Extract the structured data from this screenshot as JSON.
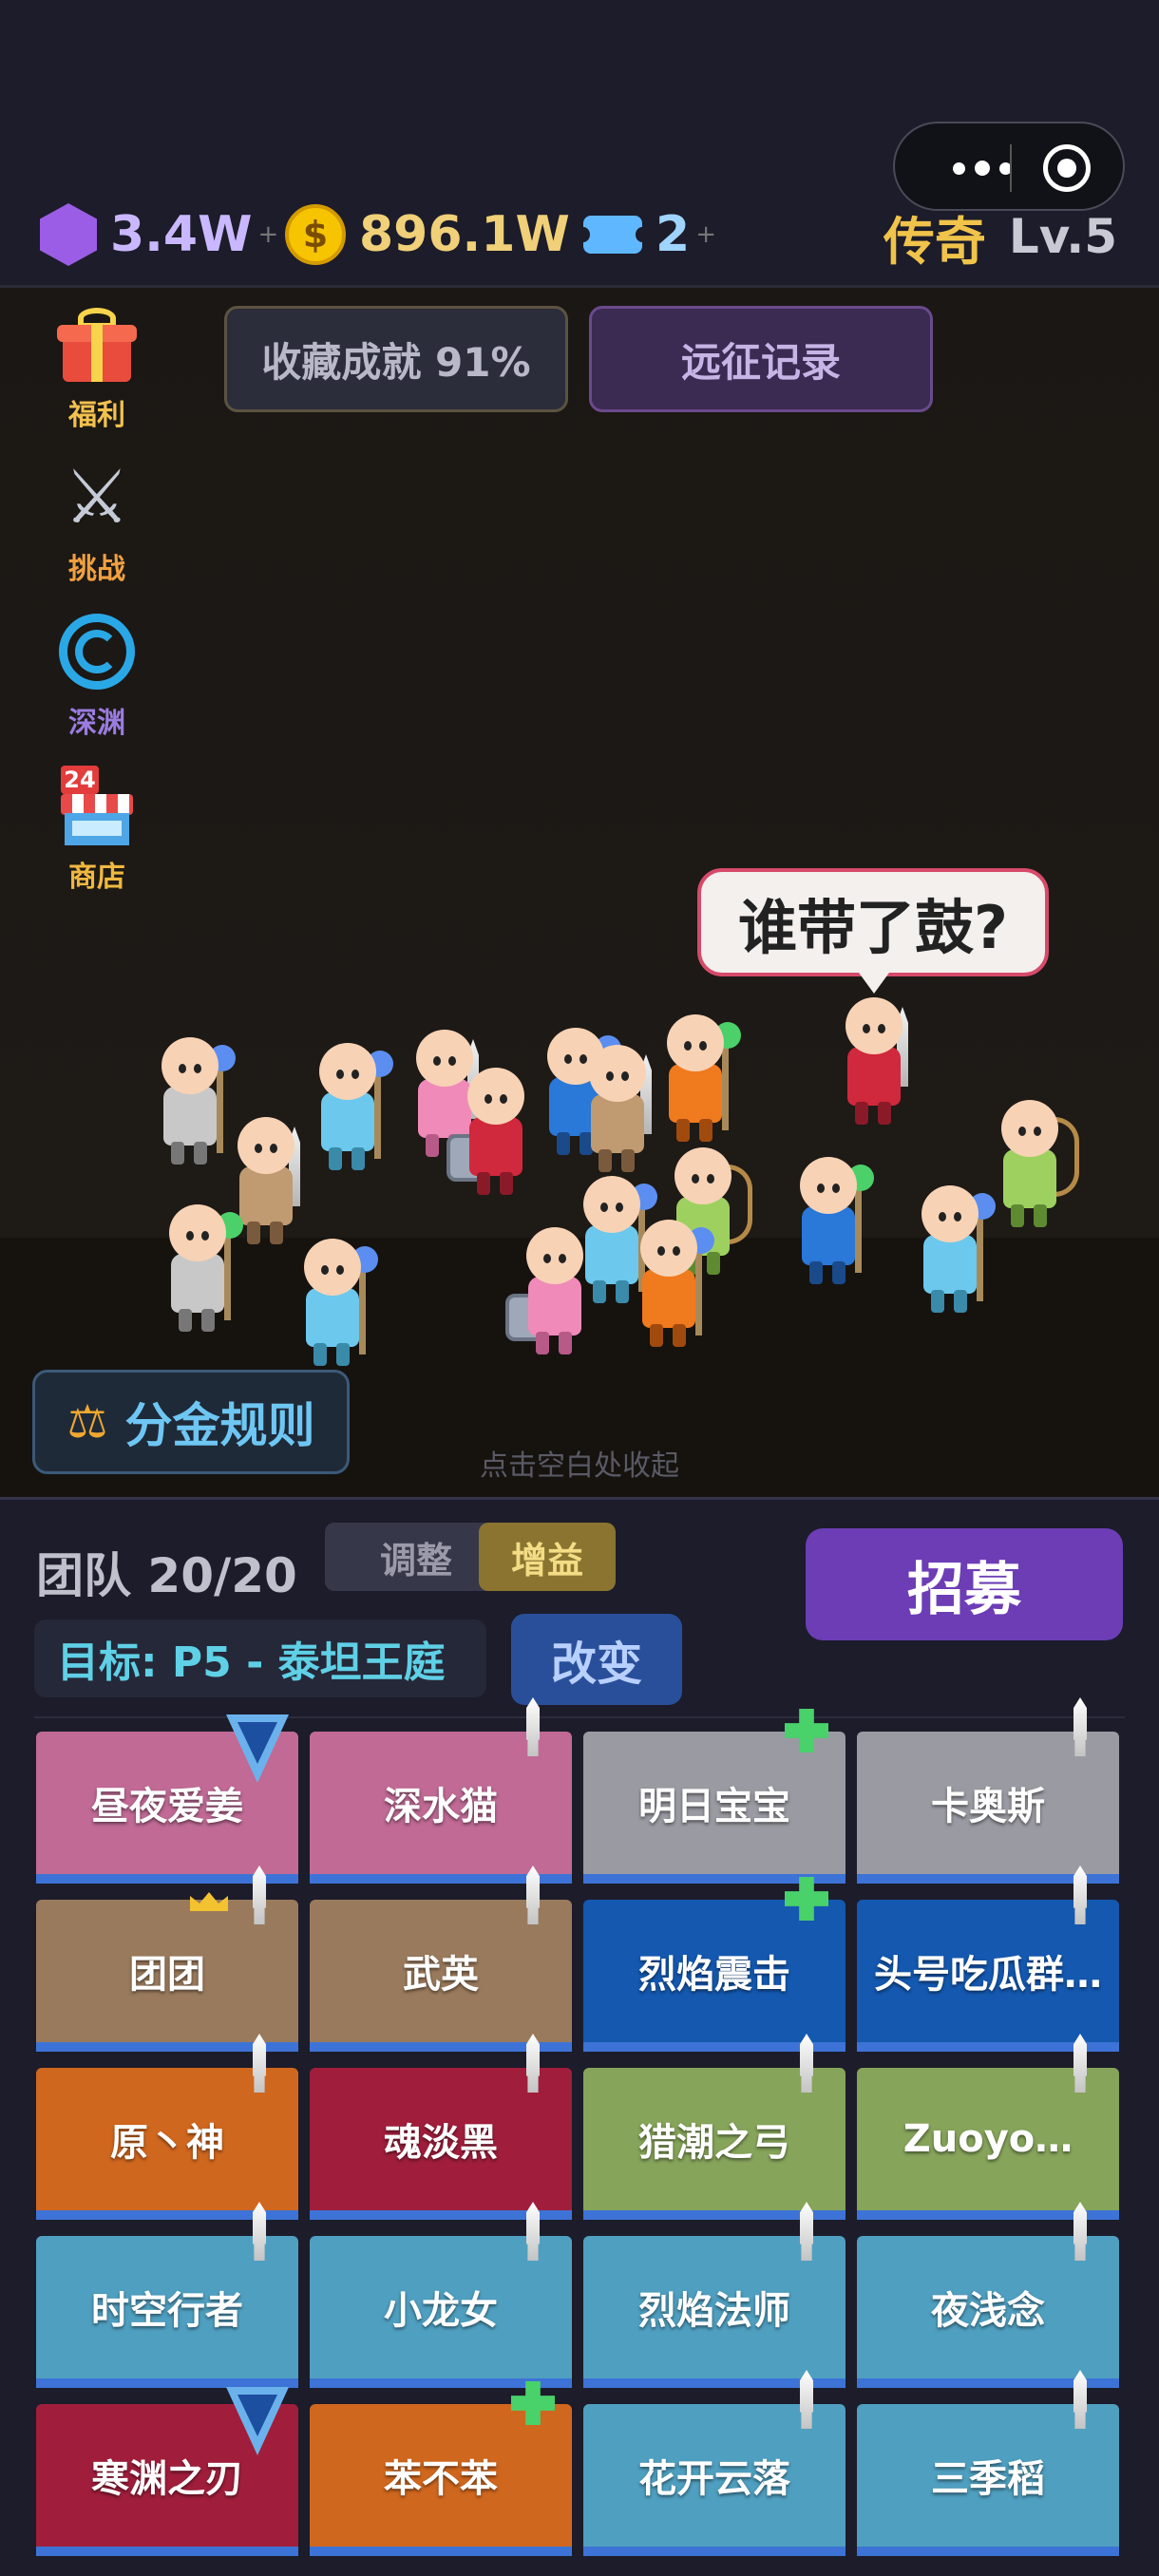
{
  "resources": {
    "gems": "3.4W",
    "coins": "896.1W",
    "coin_symbol": "$",
    "tickets": "2",
    "plus": "+"
  },
  "rank": {
    "title": "传奇",
    "level": "Lv.5"
  },
  "side_menu": [
    {
      "label": "福利",
      "color": "#f2c14e",
      "icon": "gift-icon"
    },
    {
      "label": "挑战",
      "color": "#f0a040",
      "icon": "crossed-swords-icon"
    },
    {
      "label": "深渊",
      "color": "#9b7ce0",
      "icon": "vortex-icon"
    },
    {
      "label": "商店",
      "color": "#f0b840",
      "icon": "shop-icon",
      "badge": "24"
    }
  ],
  "top_buttons": {
    "collection": "收藏成就 91%",
    "records": "远征记录"
  },
  "speech_bubble": "谁带了鼓?",
  "rules_button": "分金规则",
  "hint": "点击空白处收起",
  "panel": {
    "team_label": "团队 20/20",
    "adjust": "调整",
    "buff": "增益",
    "recruit": "招募",
    "goal": "目标: P5 - 泰坦王庭",
    "change": "改变"
  },
  "team_cards": [
    {
      "name": "昼夜爱姜",
      "color": "#c06a95",
      "mark": "shield"
    },
    {
      "name": "深水猫",
      "color": "#c06a95",
      "mark": "sword"
    },
    {
      "name": "明日宝宝",
      "color": "#9a9aa2",
      "mark": "heal"
    },
    {
      "name": "卡奥斯",
      "color": "#9a9aa2",
      "mark": "sword"
    },
    {
      "name": "团团",
      "color": "#9a7a5c",
      "mark": "crown-sword"
    },
    {
      "name": "武英",
      "color": "#9a7a5c",
      "mark": "sword"
    },
    {
      "name": "烈焰震击",
      "color": "#1458b0",
      "mark": "heal"
    },
    {
      "name": "头号吃瓜群…",
      "color": "#1458b0",
      "mark": "sword"
    },
    {
      "name": "原丶神",
      "color": "#d0671e",
      "mark": "sword"
    },
    {
      "name": "魂淡黑",
      "color": "#a01e3c",
      "mark": "sword"
    },
    {
      "name": "猎潮之弓",
      "color": "#86a45a",
      "mark": "sword"
    },
    {
      "name": "Zuoyo…",
      "color": "#86a45a",
      "mark": "sword"
    },
    {
      "name": "时空行者",
      "color": "#4f9fc0",
      "mark": "sword"
    },
    {
      "name": "小龙女",
      "color": "#4f9fc0",
      "mark": "sword"
    },
    {
      "name": "烈焰法师",
      "color": "#4f9fc0",
      "mark": "sword"
    },
    {
      "name": "夜浅念",
      "color": "#4f9fc0",
      "mark": "sword"
    },
    {
      "name": "寒渊之刃",
      "color": "#a01e3c",
      "mark": "shield"
    },
    {
      "name": "苯不苯",
      "color": "#d0671e",
      "mark": "heal"
    },
    {
      "name": "花开云落",
      "color": "#4f9fc0",
      "mark": "sword"
    },
    {
      "name": "三季稻",
      "color": "#4f9fc0",
      "mark": "sword"
    }
  ]
}
